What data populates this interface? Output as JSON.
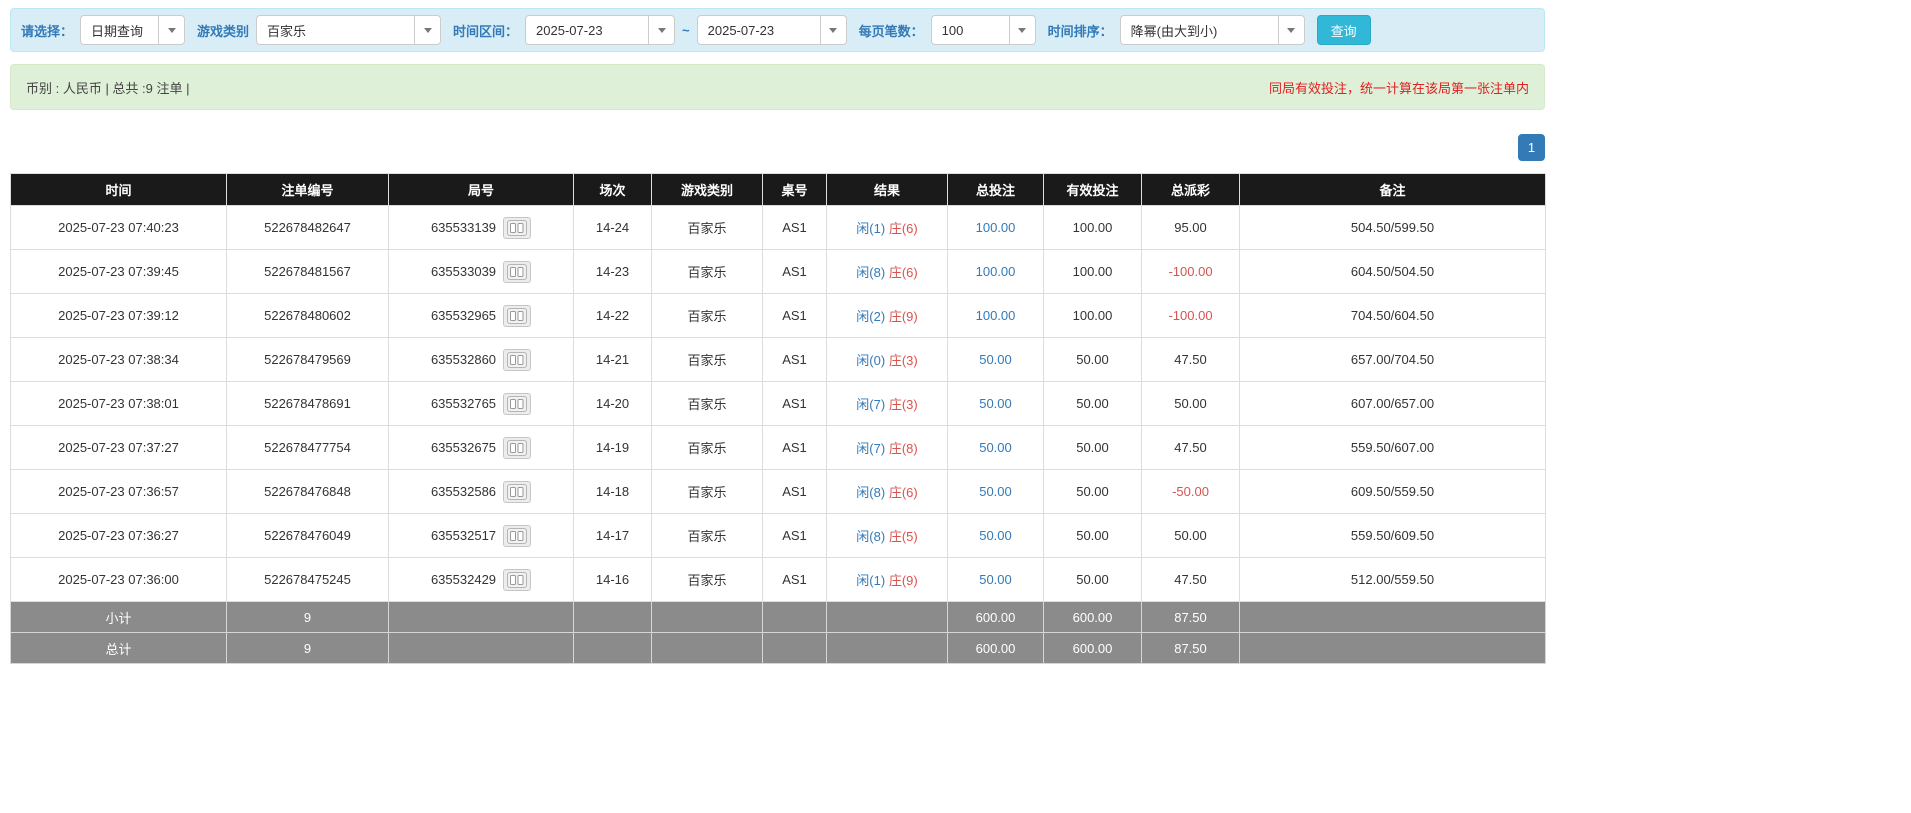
{
  "colors": {
    "accent_blue": "#337ab7",
    "danger_red": "#d9534f",
    "notice_red": "#e02020",
    "query_button_cyan": "#31b7d8",
    "table_header_black": "#1a1a1a",
    "table_footer_gray": "#8b8b8b",
    "filter_bar_blue": "#d9edf7",
    "summary_bar_green": "#dff0d8"
  },
  "filters": {
    "select_label": "请选择：",
    "select_value": "日期查询",
    "game_label": "游戏类别",
    "game_value": "百家乐",
    "range_label": "时间区间：",
    "date_from": "2025-07-23",
    "range_separator": "~",
    "date_to": "2025-07-23",
    "page_size_label": "每页笔数：",
    "page_size_value": "100",
    "sort_label": "时间排序：",
    "sort_value": "降幂(由大到小)",
    "query_button_label": "查询"
  },
  "summary": {
    "left_text": "币别 : 人民币 | 总共 :9 注单 |",
    "right_notice": "同局有效投注，统一计算在该局第一张注单内"
  },
  "pagination": {
    "current_page": "1"
  },
  "table": {
    "headers": [
      "时间",
      "注单编号",
      "局号",
      "场次",
      "游戏类别",
      "桌号",
      "结果",
      "总投注",
      "有效投注",
      "总派彩",
      "备注"
    ],
    "rows": [
      {
        "time": "2025-07-23 07:40:23",
        "bet_no": "522678482647",
        "round_no": "635533139",
        "session": "14-24",
        "game": "百家乐",
        "table_no": "AS1",
        "player": "闲(1)",
        "banker": "庄(6)",
        "total_bet": "100.00",
        "valid_bet": "100.00",
        "payout": "95.00",
        "payout_neg": false,
        "remark": "504.50/599.50"
      },
      {
        "time": "2025-07-23 07:39:45",
        "bet_no": "522678481567",
        "round_no": "635533039",
        "session": "14-23",
        "game": "百家乐",
        "table_no": "AS1",
        "player": "闲(8)",
        "banker": "庄(6)",
        "total_bet": "100.00",
        "valid_bet": "100.00",
        "payout": "-100.00",
        "payout_neg": true,
        "remark": "604.50/504.50"
      },
      {
        "time": "2025-07-23 07:39:12",
        "bet_no": "522678480602",
        "round_no": "635532965",
        "session": "14-22",
        "game": "百家乐",
        "table_no": "AS1",
        "player": "闲(2)",
        "banker": "庄(9)",
        "total_bet": "100.00",
        "valid_bet": "100.00",
        "payout": "-100.00",
        "payout_neg": true,
        "remark": "704.50/604.50"
      },
      {
        "time": "2025-07-23 07:38:34",
        "bet_no": "522678479569",
        "round_no": "635532860",
        "session": "14-21",
        "game": "百家乐",
        "table_no": "AS1",
        "player": "闲(0)",
        "banker": "庄(3)",
        "total_bet": "50.00",
        "valid_bet": "50.00",
        "payout": "47.50",
        "payout_neg": false,
        "remark": "657.00/704.50"
      },
      {
        "time": "2025-07-23 07:38:01",
        "bet_no": "522678478691",
        "round_no": "635532765",
        "session": "14-20",
        "game": "百家乐",
        "table_no": "AS1",
        "player": "闲(7)",
        "banker": "庄(3)",
        "total_bet": "50.00",
        "valid_bet": "50.00",
        "payout": "50.00",
        "payout_neg": false,
        "remark": "607.00/657.00"
      },
      {
        "time": "2025-07-23 07:37:27",
        "bet_no": "522678477754",
        "round_no": "635532675",
        "session": "14-19",
        "game": "百家乐",
        "table_no": "AS1",
        "player": "闲(7)",
        "banker": "庄(8)",
        "total_bet": "50.00",
        "valid_bet": "50.00",
        "payout": "47.50",
        "payout_neg": false,
        "remark": "559.50/607.00"
      },
      {
        "time": "2025-07-23 07:36:57",
        "bet_no": "522678476848",
        "round_no": "635532586",
        "session": "14-18",
        "game": "百家乐",
        "table_no": "AS1",
        "player": "闲(8)",
        "banker": "庄(6)",
        "total_bet": "50.00",
        "valid_bet": "50.00",
        "payout": "-50.00",
        "payout_neg": true,
        "remark": "609.50/559.50"
      },
      {
        "time": "2025-07-23 07:36:27",
        "bet_no": "522678476049",
        "round_no": "635532517",
        "session": "14-17",
        "game": "百家乐",
        "table_no": "AS1",
        "player": "闲(8)",
        "banker": "庄(5)",
        "total_bet": "50.00",
        "valid_bet": "50.00",
        "payout": "50.00",
        "payout_neg": false,
        "remark": "559.50/609.50"
      },
      {
        "time": "2025-07-23 07:36:00",
        "bet_no": "522678475245",
        "round_no": "635532429",
        "session": "14-16",
        "game": "百家乐",
        "table_no": "AS1",
        "player": "闲(1)",
        "banker": "庄(9)",
        "total_bet": "50.00",
        "valid_bet": "50.00",
        "payout": "47.50",
        "payout_neg": false,
        "remark": "512.00/559.50"
      }
    ],
    "footer_rows": [
      {
        "label": "小计",
        "count": "9",
        "total_bet": "600.00",
        "valid_bet": "600.00",
        "payout": "87.50"
      },
      {
        "label": "总计",
        "count": "9",
        "total_bet": "600.00",
        "valid_bet": "600.00",
        "payout": "87.50"
      }
    ]
  }
}
